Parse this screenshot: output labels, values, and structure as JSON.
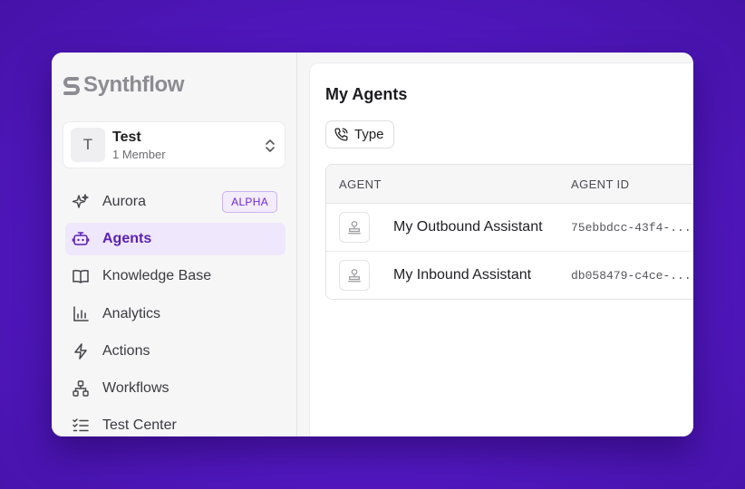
{
  "brand": {
    "name": "Synthflow"
  },
  "workspace": {
    "initial": "T",
    "name": "Test",
    "members": "1 Member"
  },
  "nav": {
    "items": [
      {
        "label": "Aurora",
        "badge": "ALPHA",
        "icon": "sparkles-icon"
      },
      {
        "label": "Agents",
        "icon": "bot-icon",
        "active": true
      },
      {
        "label": "Knowledge Base",
        "icon": "book-icon"
      },
      {
        "label": "Analytics",
        "icon": "bar-chart-icon"
      },
      {
        "label": "Actions",
        "icon": "lightning-icon"
      },
      {
        "label": "Workflows",
        "icon": "workflow-icon"
      },
      {
        "label": "Test Center",
        "icon": "checklist-icon"
      }
    ]
  },
  "main": {
    "title": "My Agents",
    "filter_label": "Type",
    "table": {
      "columns": [
        "AGENT",
        "AGENT ID"
      ],
      "rows": [
        {
          "name": "My Outbound Assistant",
          "id": "75ebbdcc-43f4-..."
        },
        {
          "name": "My Inbound Assistant",
          "id": "db058479-c4ce-..."
        }
      ]
    }
  },
  "colors": {
    "accent": "#6d28d9",
    "active_bg": "#efe7fb",
    "background": "#5418c4"
  }
}
